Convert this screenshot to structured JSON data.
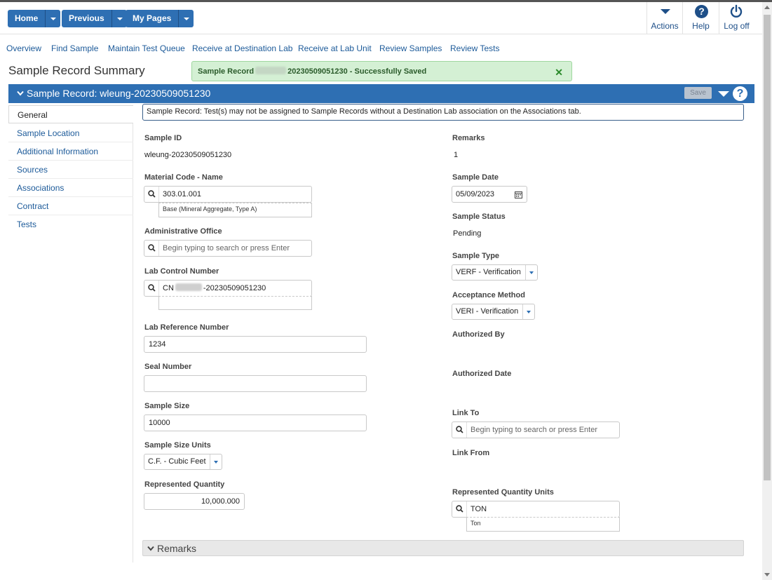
{
  "toolbar": {
    "home_label": "Home",
    "previous_label": "Previous",
    "mypages_label": "My Pages",
    "actions_label": "Actions",
    "help_label": "Help",
    "logoff_label": "Log off"
  },
  "nav_links": [
    "Overview",
    "Find Sample",
    "Maintain Test Queue",
    "Receive at Destination Lab",
    "Receive at Lab Unit",
    "Review Samples",
    "Review Tests"
  ],
  "page_title": "Sample Record Summary",
  "toast": {
    "prefix": "Sample Record",
    "suffix": "20230509051230 - Successfully Saved",
    "close": "✕"
  },
  "header": {
    "title": "Sample Record: wleung-20230509051230",
    "save_label": "Save",
    "help_icon": "?"
  },
  "side_tabs": [
    "General",
    "Sample Location",
    "Additional Information",
    "Sources",
    "Associations",
    "Contract",
    "Tests"
  ],
  "info_message": "Sample Record: Test(s) may not be assigned to Sample Records without a Destination Lab association on the Associations tab.",
  "left": {
    "sample_id_label": "Sample ID",
    "sample_id_value": "wleung-20230509051230",
    "material_label": "Material Code - Name",
    "material_value": "303.01.001",
    "material_desc": "Base (Mineral Aggregate, Type A)",
    "admin_office_label": "Administrative Office",
    "admin_office_placeholder": "Begin typing to search or press Enter",
    "lab_control_label": "Lab Control Number",
    "lab_control_prefix": "CN",
    "lab_control_suffix": "-20230509051230",
    "lab_ref_label": "Lab Reference Number",
    "lab_ref_value": "1234",
    "seal_label": "Seal Number",
    "seal_value": "",
    "sample_size_label": "Sample Size",
    "sample_size_value": "10000",
    "sample_units_label": "Sample Size Units",
    "sample_units_value": "C.F. - Cubic Feet",
    "rep_qty_label": "Represented Quantity",
    "rep_qty_value": "10,000.000"
  },
  "right": {
    "remarks_label": "Remarks",
    "remarks_value": "1",
    "sample_date_label": "Sample Date",
    "sample_date_value": "05/09/2023",
    "status_label": "Sample Status",
    "status_value": "Pending",
    "type_label": "Sample Type",
    "type_value": "VERF - Verification",
    "acceptance_label": "Acceptance Method",
    "acceptance_value": "VERI - Verification",
    "authorized_by_label": "Authorized By",
    "authorized_date_label": "Authorized Date",
    "link_to_label": "Link To",
    "link_to_placeholder": "Begin typing to search or press Enter",
    "link_from_label": "Link From",
    "rep_units_label": "Represented Quantity Units",
    "rep_units_value": "TON",
    "rep_units_desc": "Ton"
  },
  "remarks_section": "Remarks",
  "colors": {
    "primary": "#2e6fb3",
    "toast_bg": "#d4f0d4",
    "link": "#1c5a99"
  }
}
